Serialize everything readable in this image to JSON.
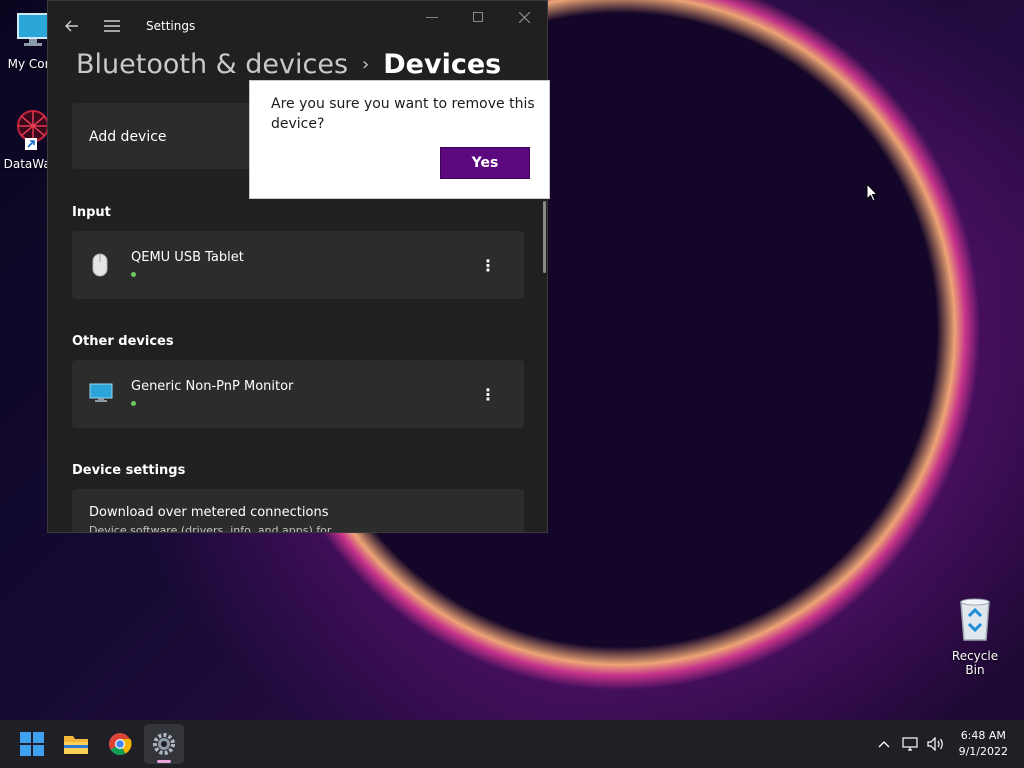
{
  "desktop": {
    "icons": [
      {
        "label": "My Com",
        "icon": "monitor-icon"
      },
      {
        "label": "DataWag",
        "icon": "datawag-icon"
      },
      {
        "label": "Recycle Bin",
        "icon": "recycle-bin-icon"
      }
    ]
  },
  "window": {
    "title": "Settings",
    "breadcrumb_parent": "Bluetooth & devices",
    "breadcrumb_separator": "›",
    "breadcrumb_current": "Devices",
    "add_device_label": "Add device",
    "sections": {
      "input": "Input",
      "other_devices": "Other devices",
      "device_settings": "Device settings"
    },
    "devices": [
      {
        "name": "QEMU USB Tablet",
        "icon": "mouse-icon",
        "status_color": "#6ccb5f"
      },
      {
        "name": "Generic Non-PnP Monitor",
        "icon": "monitor-icon",
        "status_color": "#6ccb5f"
      }
    ],
    "setting_title": "Download over metered connections",
    "setting_desc": "Device software (drivers, info, and apps) for"
  },
  "dialog": {
    "message": "Are you sure you want to remove this device?",
    "yes_label": "Yes",
    "accent": "#5c087e"
  },
  "taskbar": {
    "apps": [
      "start-icon",
      "file-explorer-icon",
      "chrome-icon",
      "settings-icon"
    ],
    "time": "6:48 AM",
    "date": "9/1/2022"
  }
}
